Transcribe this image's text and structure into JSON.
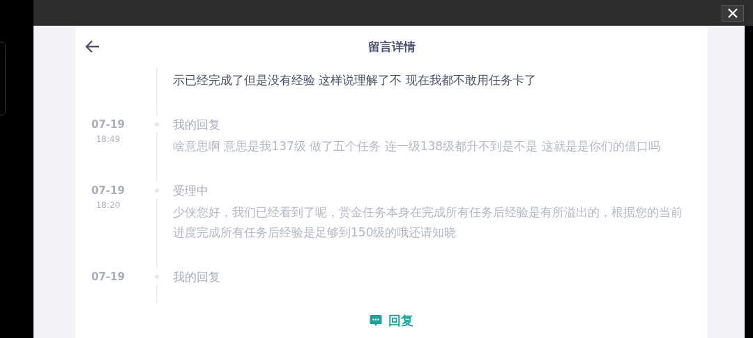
{
  "header": {
    "title": "留言详情"
  },
  "entries": [
    {
      "active": true,
      "body": "示已经完成了但是没有经验 这样说理解了不 现在我都不敢用任务卡了"
    },
    {
      "active": false,
      "date": "07-19",
      "time": "18:49",
      "title": "我的回复",
      "body": "啥意思啊 意思是我137级 做了五个任务 连一级138级都升不到是不是 这就是是你们的借口吗"
    },
    {
      "active": false,
      "date": "07-19",
      "time": "18:20",
      "title": "受理中",
      "body": "少侠您好，我们已经看到了呢，赏金任务本身在完成所有任务后经验是有所溢出的，根据您的当前进度完成所有任务后经验是足够到150级的哦还请知晓"
    },
    {
      "active": false,
      "date": "07-19",
      "title": "我的回复"
    }
  ],
  "reply_button": {
    "label": "回复"
  }
}
